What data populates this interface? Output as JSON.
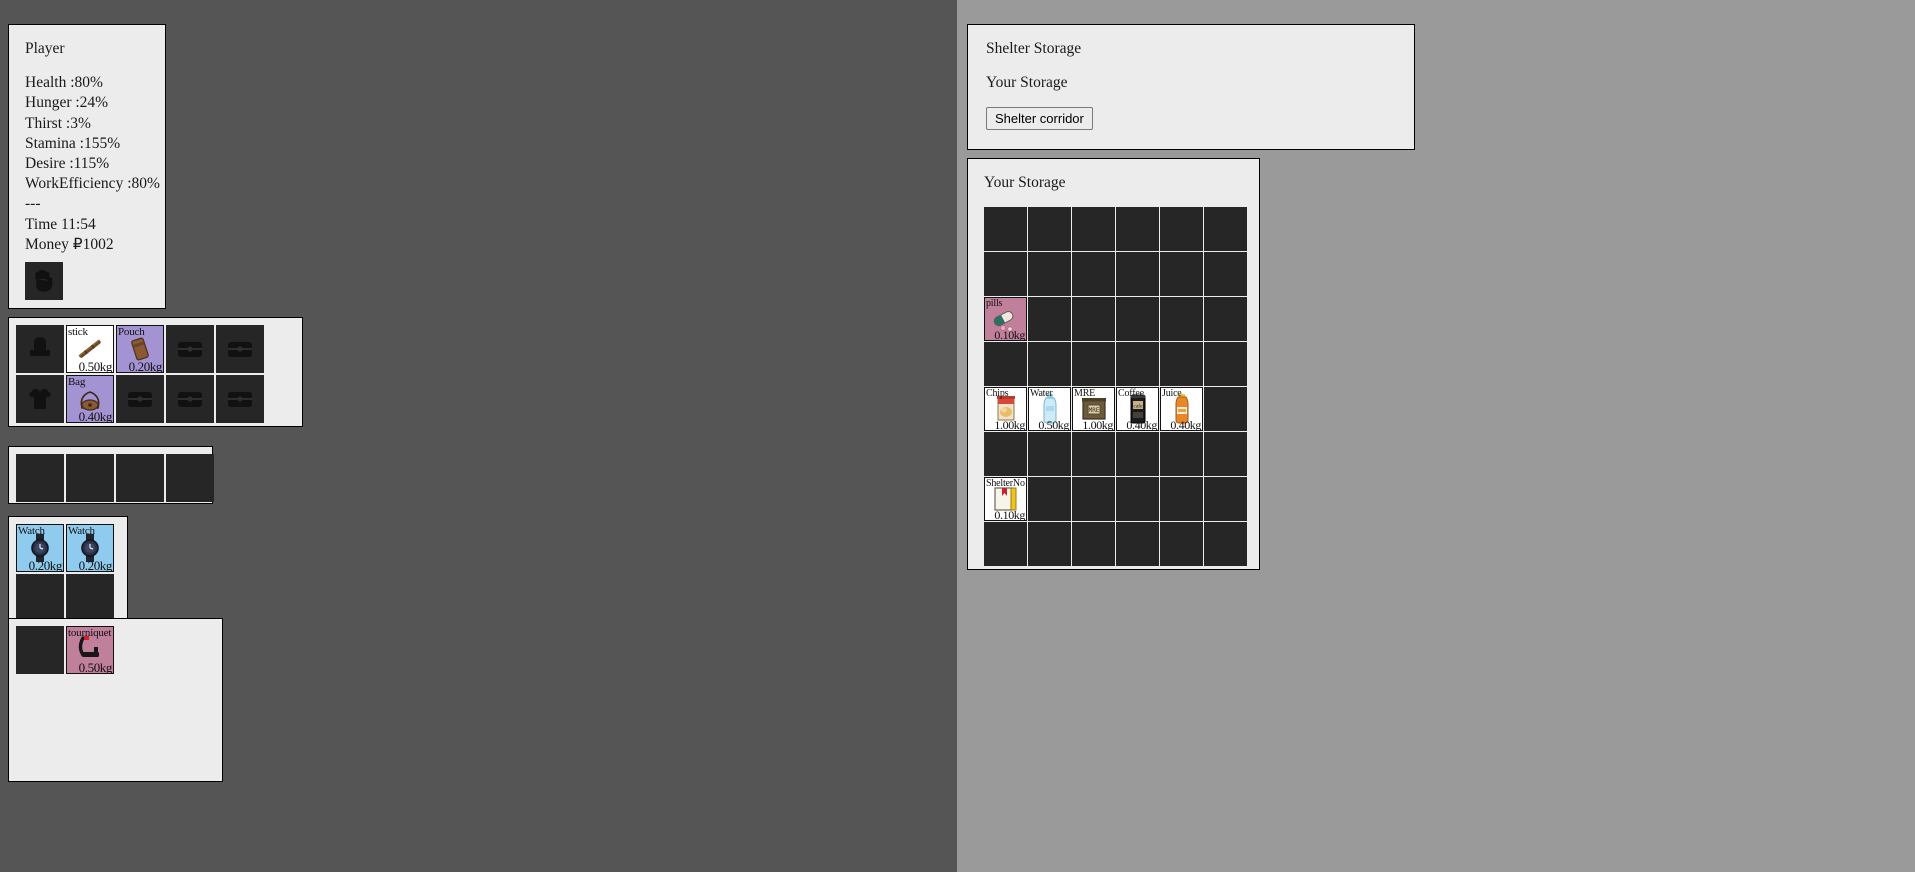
{
  "theme": {
    "left_bg": "#555555",
    "right_bg": "#9a9a9a",
    "panel_bg": "#ececec",
    "slot_empty": "#262626",
    "rarity_white": "#ffffff",
    "rarity_purple": "#a393d3",
    "rarity_blue": "#8ecbee",
    "rarity_pink": "#c07f9b"
  },
  "player": {
    "title": "Player",
    "stats": [
      "Health :80%",
      "Hunger :24%",
      "Thirst :3%",
      "Stamina :155%",
      "Desire :115%",
      "WorkEfficiency :80%"
    ],
    "divider": "---",
    "time": "Time 11:54",
    "money": "Money ₽1002",
    "hand_icon": "hand-icon"
  },
  "equipment": {
    "columns": 5,
    "rows": 2,
    "slots": [
      {
        "empty": true,
        "icon": "hat-slot-icon",
        "name": "",
        "weight": "",
        "bg": ""
      },
      {
        "empty": false,
        "icon": "stick-icon",
        "name": "stick",
        "weight": "0.50kg",
        "bg": "bg-white"
      },
      {
        "empty": false,
        "icon": "pouch-icon",
        "name": "Pouch",
        "weight": "0.20kg",
        "bg": "bg-purple"
      },
      {
        "empty": true,
        "icon": "chest-slot-icon",
        "name": "",
        "weight": "",
        "bg": ""
      },
      {
        "empty": true,
        "icon": "chest-slot-icon",
        "name": "",
        "weight": "",
        "bg": ""
      },
      {
        "empty": true,
        "icon": "shirt-slot-icon",
        "name": "",
        "weight": "",
        "bg": ""
      },
      {
        "empty": false,
        "icon": "bag-icon",
        "name": "Bag",
        "weight": "0.40kg",
        "bg": "bg-purple"
      },
      {
        "empty": true,
        "icon": "chest-slot-icon",
        "name": "",
        "weight": "",
        "bg": ""
      },
      {
        "empty": true,
        "icon": "chest-slot-icon",
        "name": "",
        "weight": "",
        "bg": ""
      },
      {
        "empty": true,
        "icon": "chest-slot-icon",
        "name": "",
        "weight": "",
        "bg": ""
      }
    ]
  },
  "hotbar": {
    "columns": 4,
    "rows": 1,
    "slots": [
      {
        "empty": true,
        "icon": "",
        "name": "",
        "weight": "",
        "bg": ""
      },
      {
        "empty": true,
        "icon": "",
        "name": "",
        "weight": "",
        "bg": ""
      },
      {
        "empty": true,
        "icon": "",
        "name": "",
        "weight": "",
        "bg": ""
      },
      {
        "empty": true,
        "icon": "",
        "name": "",
        "weight": "",
        "bg": ""
      }
    ]
  },
  "pouch_contents": {
    "columns": 2,
    "rows": 2,
    "slots": [
      {
        "empty": false,
        "icon": "watch-icon",
        "name": "Watch",
        "weight": "0.20kg",
        "bg": "bg-blue"
      },
      {
        "empty": false,
        "icon": "watch-icon",
        "name": "Watch",
        "weight": "0.20kg",
        "bg": "bg-blue"
      },
      {
        "empty": true,
        "icon": "",
        "name": "",
        "weight": "",
        "bg": ""
      },
      {
        "empty": true,
        "icon": "",
        "name": "",
        "weight": "",
        "bg": ""
      }
    ]
  },
  "bag_contents": {
    "columns": 4,
    "rows": 1,
    "slots": [
      {
        "empty": true,
        "icon": "",
        "name": "",
        "weight": "",
        "bg": ""
      },
      {
        "empty": false,
        "icon": "tourniquet-icon",
        "name": "tourniquet",
        "weight": "0.50kg",
        "bg": "bg-pink"
      }
    ]
  },
  "shelter": {
    "title": "Shelter Storage",
    "subtitle": "Your Storage",
    "corridor_button": "Shelter corridor"
  },
  "storage": {
    "title": "Your Storage",
    "columns": 6,
    "rows": 7,
    "slots": [
      {
        "empty": true,
        "icon": "",
        "name": "",
        "weight": "",
        "bg": ""
      },
      {
        "empty": true,
        "icon": "",
        "name": "",
        "weight": "",
        "bg": ""
      },
      {
        "empty": true,
        "icon": "",
        "name": "",
        "weight": "",
        "bg": ""
      },
      {
        "empty": true,
        "icon": "",
        "name": "",
        "weight": "",
        "bg": ""
      },
      {
        "empty": true,
        "icon": "",
        "name": "",
        "weight": "",
        "bg": ""
      },
      {
        "empty": true,
        "icon": "",
        "name": "",
        "weight": "",
        "bg": ""
      },
      {
        "empty": true,
        "icon": "",
        "name": "",
        "weight": "",
        "bg": ""
      },
      {
        "empty": true,
        "icon": "",
        "name": "",
        "weight": "",
        "bg": ""
      },
      {
        "empty": true,
        "icon": "",
        "name": "",
        "weight": "",
        "bg": ""
      },
      {
        "empty": true,
        "icon": "",
        "name": "",
        "weight": "",
        "bg": ""
      },
      {
        "empty": true,
        "icon": "",
        "name": "",
        "weight": "",
        "bg": ""
      },
      {
        "empty": true,
        "icon": "",
        "name": "",
        "weight": "",
        "bg": ""
      },
      {
        "empty": false,
        "icon": "pills-icon",
        "name": "pills",
        "weight": "0.10kg",
        "bg": "bg-pink"
      },
      {
        "empty": true,
        "icon": "",
        "name": "",
        "weight": "",
        "bg": ""
      },
      {
        "empty": true,
        "icon": "",
        "name": "",
        "weight": "",
        "bg": ""
      },
      {
        "empty": true,
        "icon": "",
        "name": "",
        "weight": "",
        "bg": ""
      },
      {
        "empty": true,
        "icon": "",
        "name": "",
        "weight": "",
        "bg": ""
      },
      {
        "empty": true,
        "icon": "",
        "name": "",
        "weight": "",
        "bg": ""
      },
      {
        "empty": true,
        "icon": "",
        "name": "",
        "weight": "",
        "bg": ""
      },
      {
        "empty": true,
        "icon": "",
        "name": "",
        "weight": "",
        "bg": ""
      },
      {
        "empty": true,
        "icon": "",
        "name": "",
        "weight": "",
        "bg": ""
      },
      {
        "empty": true,
        "icon": "",
        "name": "",
        "weight": "",
        "bg": ""
      },
      {
        "empty": true,
        "icon": "",
        "name": "",
        "weight": "",
        "bg": ""
      },
      {
        "empty": true,
        "icon": "",
        "name": "",
        "weight": "",
        "bg": ""
      },
      {
        "empty": false,
        "icon": "chips-icon",
        "name": "Chips",
        "weight": "1.00kg",
        "bg": "bg-white"
      },
      {
        "empty": false,
        "icon": "water-icon",
        "name": "Water",
        "weight": "0.50kg",
        "bg": "bg-white"
      },
      {
        "empty": false,
        "icon": "mre-icon",
        "name": "MRE",
        "weight": "1.00kg",
        "bg": "bg-white"
      },
      {
        "empty": false,
        "icon": "coffee-icon",
        "name": "Coffee",
        "weight": "0.40kg",
        "bg": "bg-white"
      },
      {
        "empty": false,
        "icon": "juice-icon",
        "name": "Juice",
        "weight": "0.40kg",
        "bg": "bg-white"
      },
      {
        "empty": true,
        "icon": "",
        "name": "",
        "weight": "",
        "bg": ""
      },
      {
        "empty": true,
        "icon": "",
        "name": "",
        "weight": "",
        "bg": ""
      },
      {
        "empty": true,
        "icon": "",
        "name": "",
        "weight": "",
        "bg": ""
      },
      {
        "empty": true,
        "icon": "",
        "name": "",
        "weight": "",
        "bg": ""
      },
      {
        "empty": true,
        "icon": "",
        "name": "",
        "weight": "",
        "bg": ""
      },
      {
        "empty": true,
        "icon": "",
        "name": "",
        "weight": "",
        "bg": ""
      },
      {
        "empty": true,
        "icon": "",
        "name": "",
        "weight": "",
        "bg": ""
      },
      {
        "empty": false,
        "icon": "note-icon",
        "name": "ShelterNo",
        "weight": "0.10kg",
        "bg": "bg-white"
      },
      {
        "empty": true,
        "icon": "",
        "name": "",
        "weight": "",
        "bg": ""
      },
      {
        "empty": true,
        "icon": "",
        "name": "",
        "weight": "",
        "bg": ""
      },
      {
        "empty": true,
        "icon": "",
        "name": "",
        "weight": "",
        "bg": ""
      },
      {
        "empty": true,
        "icon": "",
        "name": "",
        "weight": "",
        "bg": ""
      },
      {
        "empty": true,
        "icon": "",
        "name": "",
        "weight": "",
        "bg": ""
      },
      {
        "empty": true,
        "icon": "",
        "name": "",
        "weight": "",
        "bg": ""
      },
      {
        "empty": true,
        "icon": "",
        "name": "",
        "weight": "",
        "bg": ""
      },
      {
        "empty": true,
        "icon": "",
        "name": "",
        "weight": "",
        "bg": ""
      },
      {
        "empty": true,
        "icon": "",
        "name": "",
        "weight": "",
        "bg": ""
      },
      {
        "empty": true,
        "icon": "",
        "name": "",
        "weight": "",
        "bg": ""
      },
      {
        "empty": true,
        "icon": "",
        "name": "",
        "weight": "",
        "bg": ""
      }
    ]
  }
}
